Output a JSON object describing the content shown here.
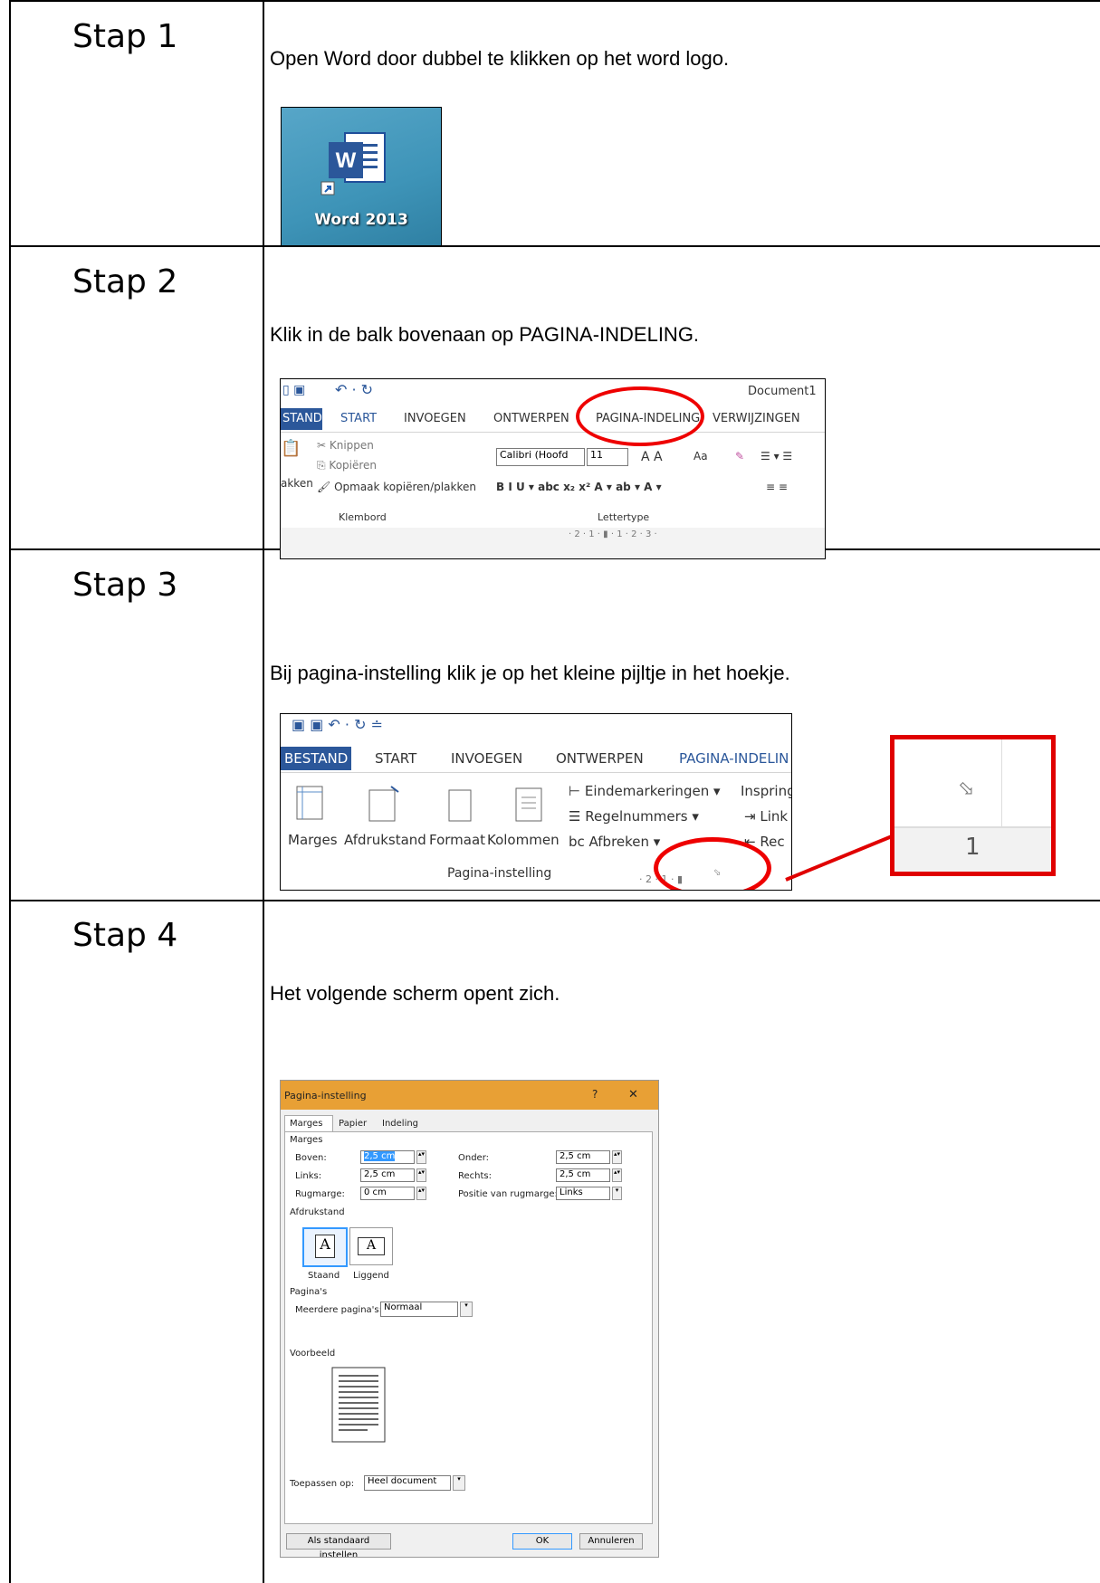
{
  "steps": [
    {
      "label": "Stap 1",
      "instruction": "Open Word door dubbel te klikken op het word logo.",
      "icon_caption": "Word 2013"
    },
    {
      "label": "Stap 2",
      "instruction": "Klik in de balk bovenaan op PAGINA-INDELING."
    },
    {
      "label": "Stap 3",
      "instruction": "Bij pagina-instelling klik je op het kleine pijltje in het hoekje."
    },
    {
      "label": "Stap 4",
      "instruction": "Het volgende scherm opent zich."
    }
  ],
  "ribbon2": {
    "doc_title": "Document1",
    "tabs": [
      "STAND",
      "START",
      "INVOEGEN",
      "ONTWERPEN",
      "PAGINA-INDELING",
      "VERWIJZINGEN"
    ],
    "knippen": "Knippen",
    "kopieren": "Kopiëren",
    "plakken": "akken",
    "opmaak": "Opmaak kopiëren/plakken",
    "font": "Calibri (Hoofd",
    "size": "11",
    "aa": "Aa",
    "group1": "Klembord",
    "group2": "Lettertype",
    "ruler": "· 2 · 1 · ▮ · 1 · 2 · 3 ·"
  },
  "ribbon3": {
    "tabs": [
      "BESTAND",
      "START",
      "INVOEGEN",
      "ONTWERPEN",
      "PAGINA-INDELIN"
    ],
    "btns": [
      "Marges",
      "Afdrukstand",
      "Formaat",
      "Kolommen"
    ],
    "eind": "Eindemarkeringen",
    "regel": "Regelnummers",
    "afbreken": "Afbreken",
    "inspring": "Inspring",
    "links": "Link",
    "rechts": "Rec",
    "group": "Pagina-instelling",
    "ruler": "· 2 · 1 · ▮",
    "zoom_ruler": "1"
  },
  "dialog": {
    "title": "Pagina-instelling",
    "help": "?",
    "close": "✕",
    "tabs": [
      "Marges",
      "Papier",
      "Indeling"
    ],
    "sec_marges": "Marges",
    "boven_label": "Boven:",
    "boven": "2,5 cm",
    "onder_label": "Onder:",
    "onder": "2,5 cm",
    "links_label": "Links:",
    "links": "2,5 cm",
    "rechts_label": "Rechts:",
    "rechts": "2,5 cm",
    "rug_label": "Rugmarge:",
    "rug": "0 cm",
    "pos_label": "Positie van rugmarge:",
    "pos": "Links",
    "sec_afdruk": "Afdrukstand",
    "staand": "Staand",
    "liggend": "Liggend",
    "sec_paginas": "Pagina's",
    "meer_label": "Meerdere pagina's:",
    "meer": "Normaal",
    "sec_voorbeeld": "Voorbeeld",
    "toepassen_label": "Toepassen op:",
    "toepassen": "Heel document",
    "standaard": "Als standaard instellen",
    "ok": "OK",
    "annuleren": "Annuleren"
  },
  "colors": {
    "accent_word": "#2b579a",
    "dialog_title": "#e8a035",
    "red": "#e00000"
  }
}
